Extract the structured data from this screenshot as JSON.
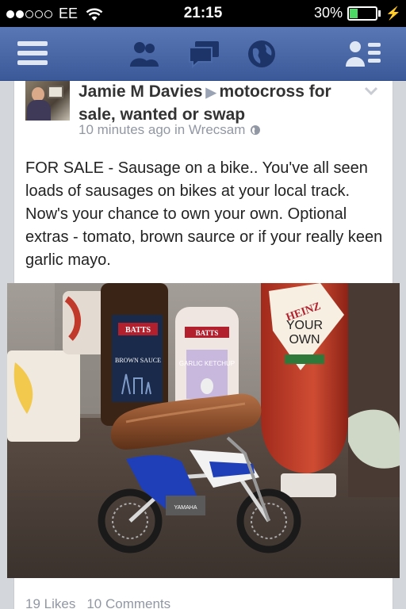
{
  "status_bar": {
    "carrier": "EE",
    "time": "21:15",
    "battery_percent": "30%",
    "battery_level": 0.3
  },
  "nav": {
    "icons": [
      "menu-icon",
      "friends-icon",
      "messages-icon",
      "globe-icon",
      "profile-menu-icon"
    ]
  },
  "post": {
    "author": "Jamie M Davies",
    "group": "motocross for sale, wanted or swap",
    "time": "10 minutes ago in Wrecsam",
    "text": "FOR SALE - Sausage on a bike..  You've all seen loads of sausages on bikes at your local track.  Now's your chance to own your own.  Optional extras - tomato, brown saurce or if your really keen garlic mayo.",
    "likes": "19 Likes",
    "comments": "10 Comments"
  },
  "photo": {
    "bottle1_brand": "BATTS",
    "bottle1_label": "BROWN SAUCE",
    "bottle2_brand": "BATTS",
    "bottle2_label": "GARLIC KETCHUP",
    "bottle3_brand": "HEINZ",
    "bottle3_label1": "YOUR",
    "bottle3_label2": "OWN",
    "bike_brand": "YAMAHA"
  },
  "colors": {
    "nav_blue": "#3b5998",
    "text_gray": "#9197a3",
    "battery_green": "#4cd964"
  }
}
